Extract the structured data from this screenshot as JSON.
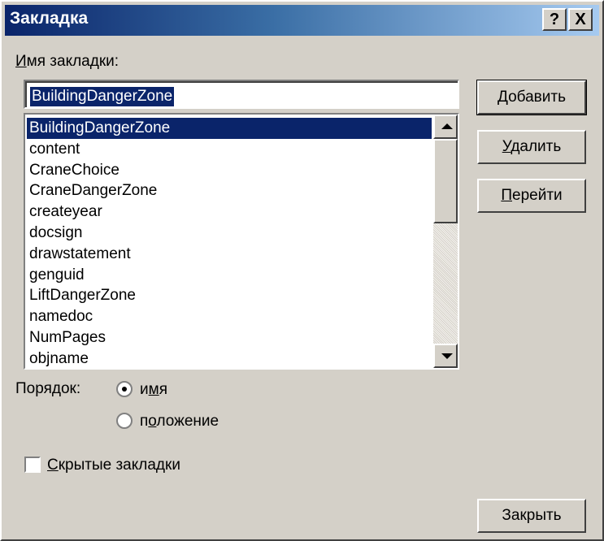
{
  "window": {
    "title": "Закладка",
    "help_glyph": "?",
    "close_glyph": "X"
  },
  "name_label": {
    "first": "И",
    "rest": "мя закладки:"
  },
  "name_input": {
    "value": "BuildingDangerZone"
  },
  "bookmarks": [
    "BuildingDangerZone",
    "content",
    "CraneChoice",
    "CraneDangerZone",
    "createyear",
    "docsign",
    "drawstatement",
    "genguid",
    "LiftDangerZone",
    "namedoc",
    "NumPages",
    "objname"
  ],
  "selected_index": 0,
  "buttons": {
    "add": {
      "first": "Д",
      "rest": "обавить"
    },
    "delete": {
      "first": "У",
      "rest": "далить"
    },
    "goto": {
      "first": "П",
      "rest": "ерейти"
    },
    "close": "Закрыть"
  },
  "sort": {
    "label": "Порядок:",
    "name_option": {
      "pre": "и",
      "acc": "м",
      "post": "я"
    },
    "position_option": {
      "pre": "п",
      "acc": "о",
      "post": "ложение"
    },
    "selected": "name"
  },
  "hidden": {
    "first": "С",
    "rest": "крытые закладки",
    "checked": false
  }
}
